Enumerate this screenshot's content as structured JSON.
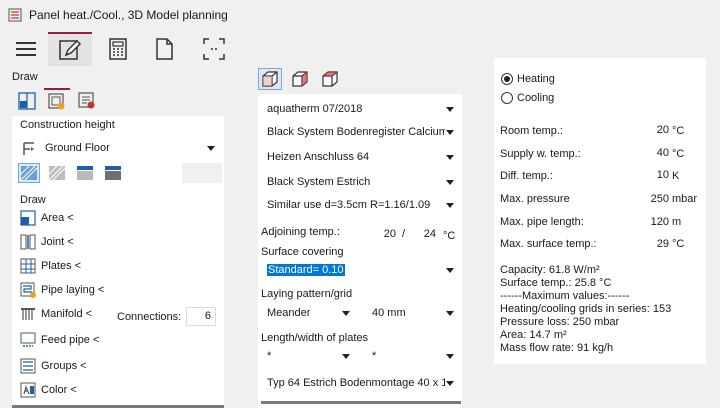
{
  "window": {
    "title": "Panel heat./Cool., 3D Model planning"
  },
  "left": {
    "section_label": "Draw",
    "construction_height_label": "Construction height",
    "floor_combo": {
      "value": "Ground Floor"
    },
    "draw_label": "Draw",
    "items": [
      {
        "label": "Area <"
      },
      {
        "label": "Joint <"
      },
      {
        "label": "Plates <"
      },
      {
        "label": "Pipe laying <"
      },
      {
        "label": "Manifold <"
      },
      {
        "label": "Feed pipe <"
      },
      {
        "label": "Groups <"
      },
      {
        "label": "Color <"
      }
    ],
    "connections_label": "Connections:",
    "connections_value": "6"
  },
  "middle": {
    "combos": [
      "aquatherm 07/2018",
      "Black System Bodenregister Calciumsu",
      "Heizen Anschluss 64",
      "Black System Estrich",
      "Similar use d=3.5cm R=1.16/1.09"
    ],
    "adjoining_label": "Adjoining temp.:",
    "adjoining_a": "20",
    "adjoining_sep": "/",
    "adjoining_b": "24",
    "adjoining_unit": "°C",
    "surface_label": "Surface covering",
    "surface_value": "Standard= 0.10",
    "laying_label": "Laying pattern/grid",
    "laying_pattern": "Meander",
    "laying_grid": "40 mm",
    "length_label": "Length/width of plates",
    "length_a": "*",
    "length_b": "*",
    "plate_combo": "Typ 64 Estrich Bodenmontage  40 x 1"
  },
  "right": {
    "mode_heating": "Heating",
    "mode_cooling": "Cooling",
    "params": [
      {
        "label": "Room temp.:",
        "value": "20",
        "unit": "°C"
      },
      {
        "label": "Supply w. temp.:",
        "value": "40",
        "unit": "°C"
      },
      {
        "label": "Diff. temp.:",
        "value": "10",
        "unit": "K"
      },
      {
        "label": "Max. pressure",
        "value": "250",
        "unit": "mbar"
      },
      {
        "label": "Max. pipe length:",
        "value": "120",
        "unit": "m"
      },
      {
        "label": "Max. surface temp.:",
        "value": "29",
        "unit": "°C"
      }
    ],
    "results": [
      "Capacity: 61.8 W/m²",
      "Surface temp.: 25.8 °C",
      "------Maximum values:------",
      "Heating/cooling grids in series: 153",
      "Pressure loss: 250 mbar",
      "Area: 14.7 m²",
      "Mass flow rate: 91 kg/h"
    ]
  },
  "colors": {
    "accent": "#9b1c4a",
    "selection": "#0078d7",
    "icon_blue": "#1f5fa8"
  }
}
